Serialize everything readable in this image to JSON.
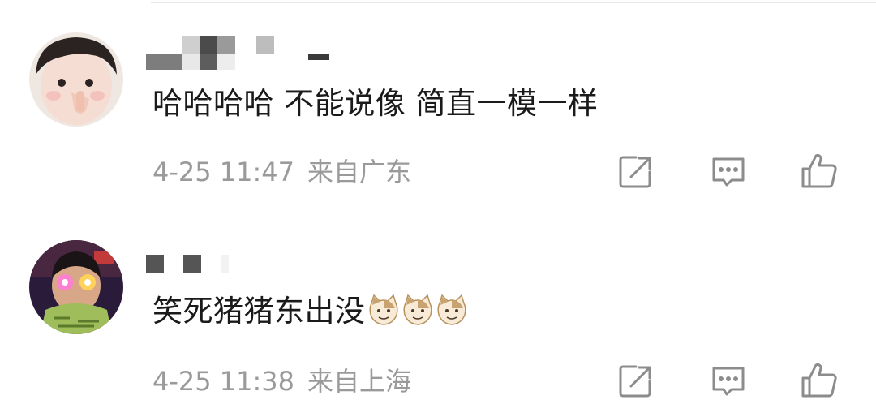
{
  "comments": [
    {
      "text": "哈哈哈哈 不能说像 简直一模一样",
      "time": "4-25 11:47",
      "location": "来自广东"
    },
    {
      "text": "笑死猪猪东出没",
      "time": "4-25 11:38",
      "location": "来自上海",
      "emojis": [
        "cat-face-emoji",
        "cat-face-emoji",
        "cat-face-emoji"
      ]
    }
  ],
  "actions": [
    "share-icon",
    "comment-icon",
    "like-icon"
  ],
  "colors": {
    "text": "#1a1a1a",
    "meta": "#9a9a9a",
    "icon": "#8c8c8c",
    "divider": "#e8e8e8"
  }
}
